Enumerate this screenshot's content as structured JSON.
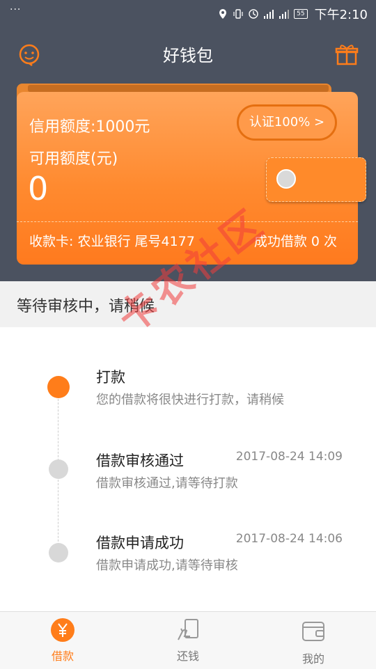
{
  "status_bar": {
    "dots": "···",
    "battery": "55",
    "time": "下午2:10"
  },
  "header": {
    "title": "好钱包",
    "left_icon": "customer-service-icon",
    "right_icon": "gift-icon"
  },
  "wallet": {
    "credit_limit_label": "信用额度:1000元",
    "available_label": "可用额度(元)",
    "available_value": "0",
    "certify_button": "认证100%  >",
    "bank_card": "收款卡: 农业银行  尾号4177",
    "success_loans": "成功借款  0  次"
  },
  "status_banner": "等待审核中，请稍候",
  "timeline": [
    {
      "title": "打款",
      "desc": "您的借款将很快进行打款，请稍候",
      "time": "",
      "active": true
    },
    {
      "title": "借款审核通过",
      "desc": "借款审核通过,请等待打款",
      "time": "2017-08-24  14:09",
      "active": false
    },
    {
      "title": "借款申请成功",
      "desc": "借款申请成功,请等待审核",
      "time": "2017-08-24  14:06",
      "active": false
    }
  ],
  "watermark": "卡农社区",
  "tabs": [
    {
      "label": "借款",
      "icon": "yen-icon",
      "active": true
    },
    {
      "label": "还钱",
      "icon": "repay-icon",
      "active": false
    },
    {
      "label": "我的",
      "icon": "wallet-icon",
      "active": false
    }
  ],
  "colors": {
    "accent": "#ff7d1a",
    "header_bg": "#4b5260",
    "inactive": "#d8d8d8"
  }
}
